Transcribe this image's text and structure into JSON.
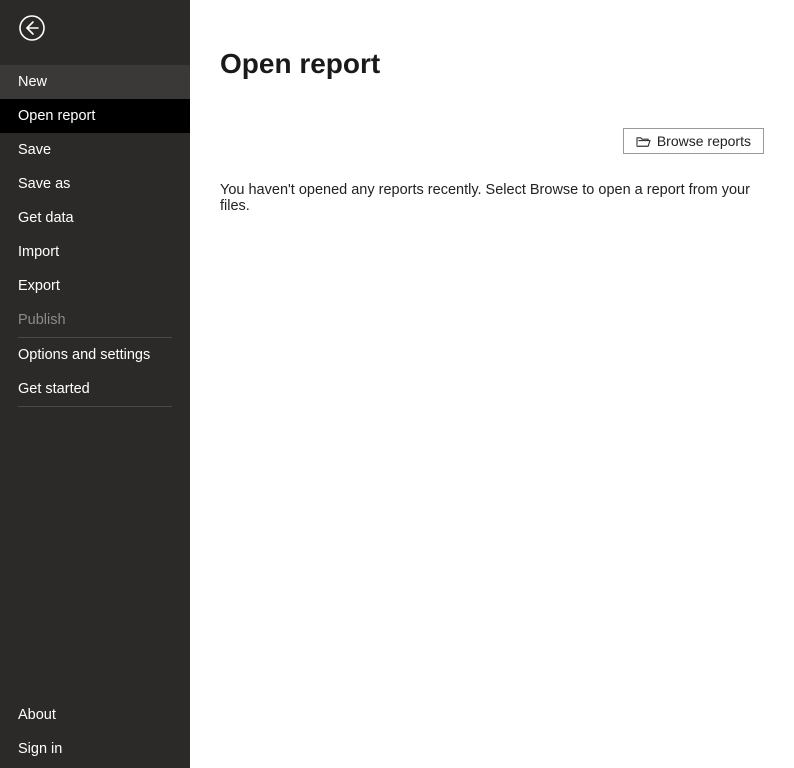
{
  "sidebar": {
    "top_items": [
      {
        "label": "New"
      },
      {
        "label": "Open report"
      },
      {
        "label": "Save"
      },
      {
        "label": "Save as"
      },
      {
        "label": "Get data"
      },
      {
        "label": "Import"
      },
      {
        "label": "Export"
      },
      {
        "label": "Publish"
      }
    ],
    "mid_items": [
      {
        "label": "Options and settings"
      },
      {
        "label": "Get started"
      }
    ],
    "bottom_items": [
      {
        "label": "About"
      },
      {
        "label": "Sign in"
      }
    ]
  },
  "main": {
    "title": "Open report",
    "browse_label": "Browse reports",
    "empty_message": "You haven't opened any reports recently. Select Browse to open a report from your files."
  }
}
